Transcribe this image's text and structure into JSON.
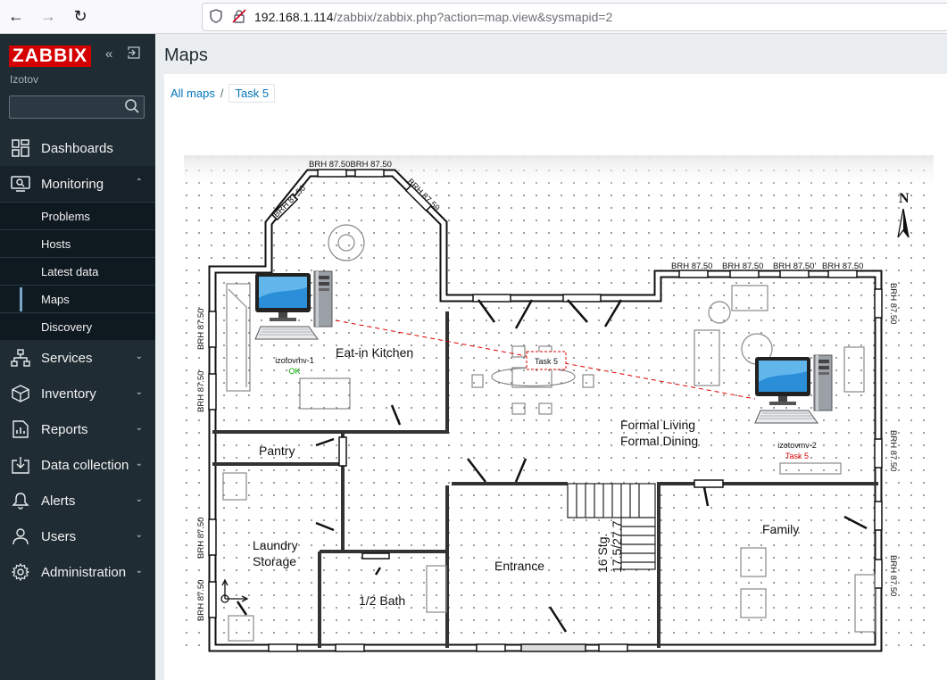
{
  "browser": {
    "url_host": "192.168.1.114",
    "url_path": "/zabbix/zabbix.php?action=map.view&sysmapid=2"
  },
  "sidebar": {
    "logo": "ZABBIX",
    "username": "Izotov",
    "search_placeholder": "",
    "menu": [
      {
        "label": "Dashboards",
        "icon": "dashboards-icon"
      },
      {
        "label": "Monitoring",
        "icon": "monitoring-icon",
        "expanded": true,
        "items": [
          "Problems",
          "Hosts",
          "Latest data",
          "Maps",
          "Discovery"
        ],
        "selected": "Maps"
      },
      {
        "label": "Services",
        "icon": "services-icon"
      },
      {
        "label": "Inventory",
        "icon": "inventory-icon"
      },
      {
        "label": "Reports",
        "icon": "reports-icon"
      },
      {
        "label": "Data collection",
        "icon": "data-collection-icon"
      },
      {
        "label": "Alerts",
        "icon": "alerts-icon"
      },
      {
        "label": "Users",
        "icon": "users-icon"
      },
      {
        "label": "Administration",
        "icon": "administration-icon"
      }
    ]
  },
  "main": {
    "title": "Maps",
    "breadcrumb": {
      "link": "All maps",
      "current": "Task 5"
    }
  },
  "map": {
    "rooms": {
      "kitchen": "Eat-in Kitchen",
      "pantry": "Pantry",
      "laundry1": "Laundry",
      "laundry2": "Storage",
      "bath": "1/2 Bath",
      "entrance": "Entrance",
      "living1": "Formal Living",
      "living2": "Formal Dining",
      "family": "Family",
      "stairs1": "16 Stg.",
      "stairs2": "17.5/27.7"
    },
    "window_label": "BRH 87.50",
    "window_label_top": "BRH 87.50BRH 87.50",
    "window_label_alt": "BRH 87.50'",
    "compass": "N",
    "link_label": "Task 5",
    "hosts": [
      {
        "name": "izotovmv-1",
        "status": "OK",
        "status_color": "#00aa00"
      },
      {
        "name": "izotovmv-2",
        "status": "Task 5",
        "status_color": "#dd0000"
      }
    ]
  }
}
